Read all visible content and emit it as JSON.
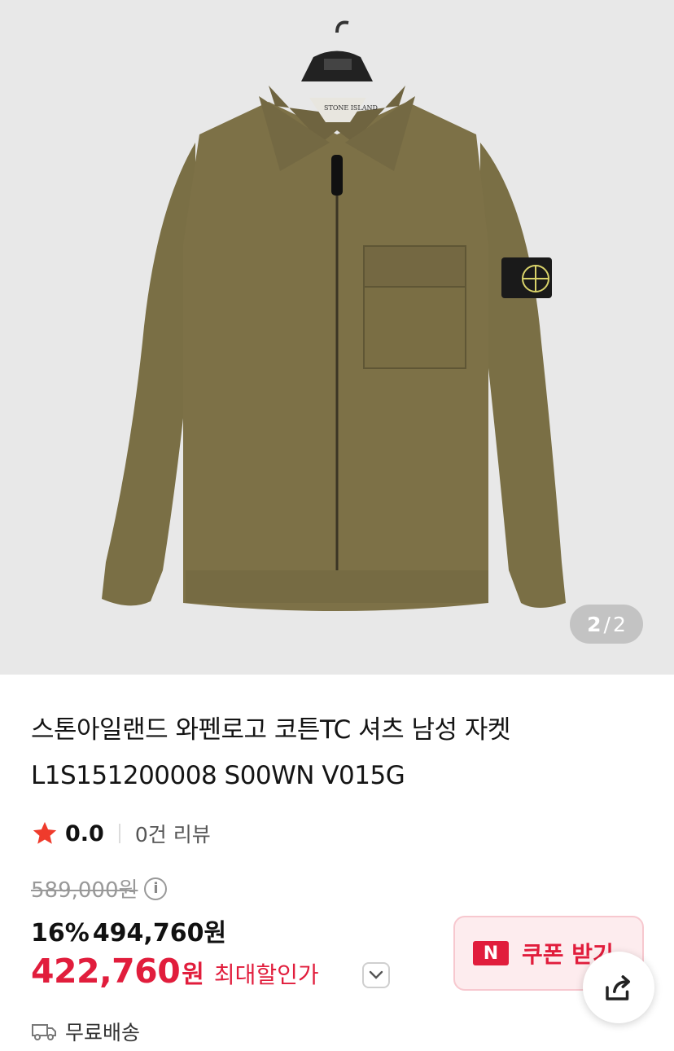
{
  "gallery": {
    "image_alt": "Olive green zip-up cotton overshirt jacket on hanger with black arm badge",
    "hanger_label": "STONE ISLAND",
    "current": "2",
    "separator": "/",
    "total": "2"
  },
  "product": {
    "title_line1": "스톤아일랜드 와펜로고 코튼TC 셔츠 남성 자켓",
    "title_line2": "L1S151200008 S00WN V015G"
  },
  "rating": {
    "score": "0.0",
    "reviews": "0건 리뷰"
  },
  "pricing": {
    "original": "589,000원",
    "discount_percent": "16%",
    "discounted": "494,760원",
    "final_value": "422,760",
    "final_unit": "원",
    "max_discount_label": "최대할인가"
  },
  "coupon": {
    "badge": "N",
    "label": "쿠폰 받기"
  },
  "shipping": {
    "label": "무료배송"
  },
  "colors": {
    "accent_red": "#e11d3c",
    "jacket_olive": "#7c7046",
    "background_gray": "#e8e8e8"
  }
}
